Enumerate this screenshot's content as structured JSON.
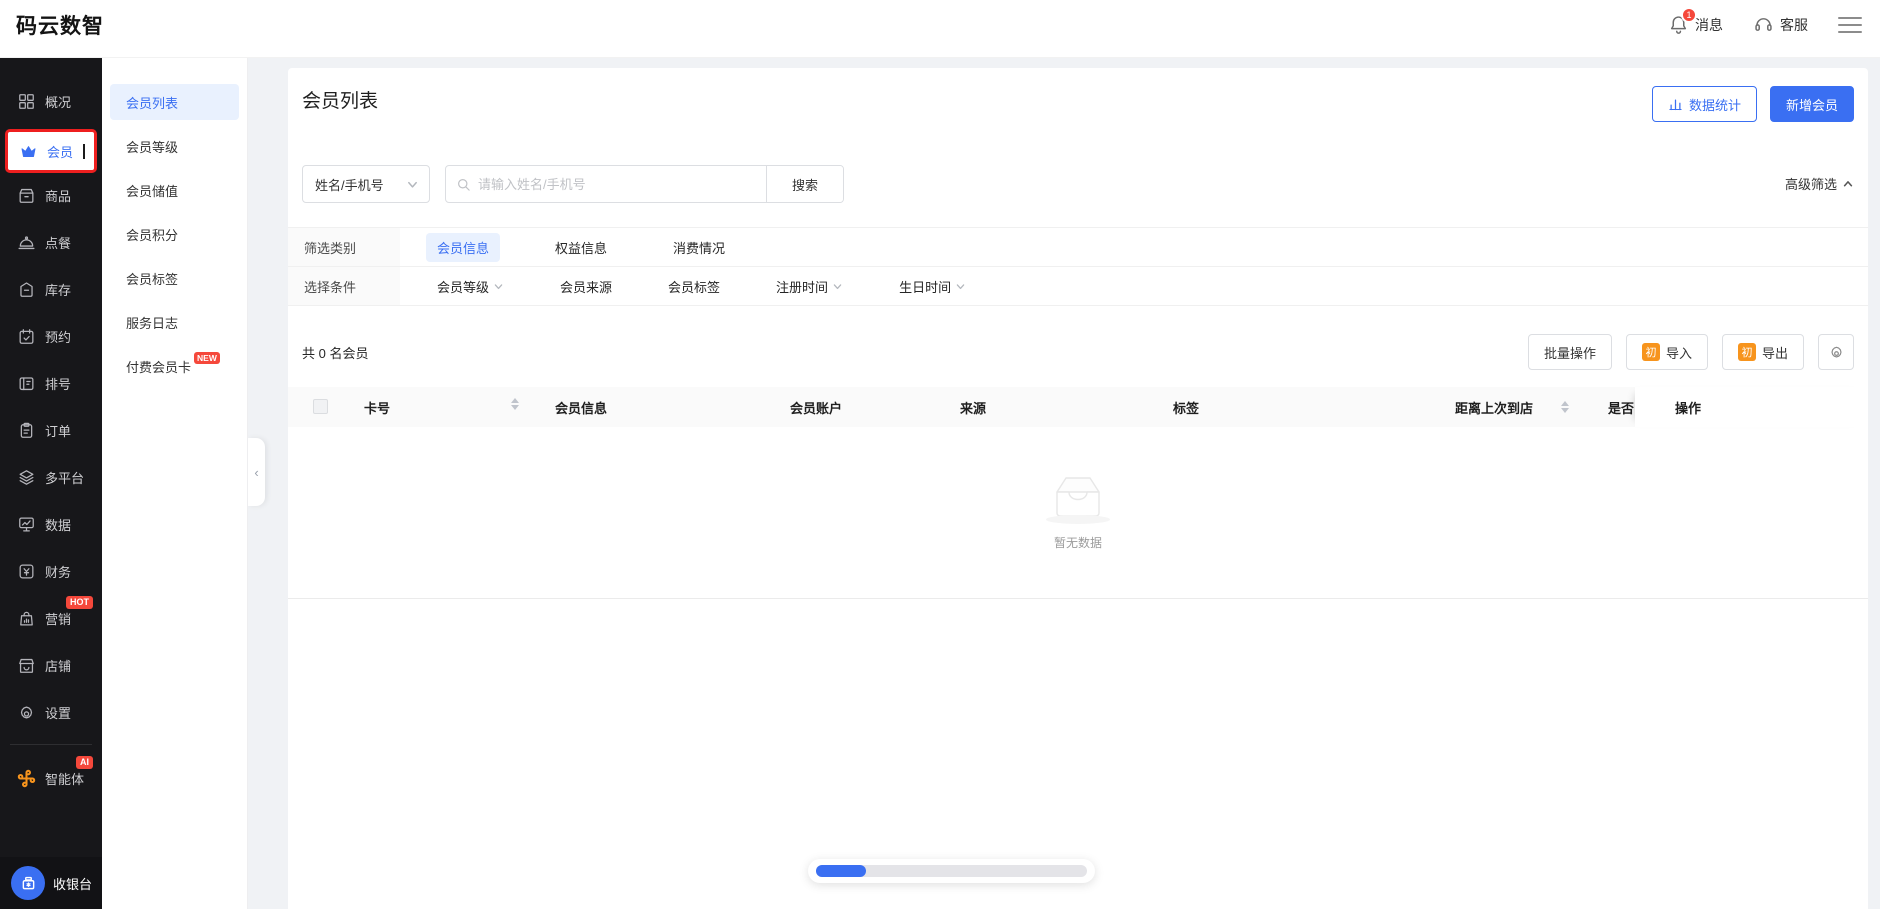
{
  "header": {
    "logo": "码云数智",
    "messages_label": "消息",
    "messages_badge": "1",
    "support_label": "客服"
  },
  "sidebar": {
    "items": [
      {
        "label": "概况",
        "icon": "grid-icon"
      },
      {
        "label": "会员",
        "icon": "crown-icon",
        "active": true
      },
      {
        "label": "商品",
        "icon": "goods-icon"
      },
      {
        "label": "点餐",
        "icon": "dish-icon"
      },
      {
        "label": "库存",
        "icon": "inventory-icon"
      },
      {
        "label": "预约",
        "icon": "calendar-icon"
      },
      {
        "label": "排号",
        "icon": "queue-icon"
      },
      {
        "label": "订单",
        "icon": "order-icon"
      },
      {
        "label": "多平台",
        "icon": "layers-icon"
      },
      {
        "label": "数据",
        "icon": "data-icon"
      },
      {
        "label": "财务",
        "icon": "finance-icon"
      },
      {
        "label": "营销",
        "icon": "marketing-icon",
        "badge": "HOT"
      },
      {
        "label": "店铺",
        "icon": "shop-icon"
      },
      {
        "label": "设置",
        "icon": "settings-icon"
      }
    ],
    "agent": {
      "label": "智能体",
      "badge": "AI"
    },
    "cashier": {
      "label": "收银台"
    }
  },
  "submenu": {
    "items": [
      {
        "label": "会员列表",
        "active": true
      },
      {
        "label": "会员等级"
      },
      {
        "label": "会员储值"
      },
      {
        "label": "会员积分"
      },
      {
        "label": "会员标签"
      },
      {
        "label": "服务日志"
      },
      {
        "label": "付费会员卡",
        "badge": "NEW"
      }
    ]
  },
  "main": {
    "title": "会员列表",
    "stats_button": "数据统计",
    "add_button": "新增会员",
    "search": {
      "field_select": "姓名/手机号",
      "placeholder": "请输入姓名/手机号",
      "search_button": "搜索",
      "advanced_filter": "高级筛选"
    },
    "filter": {
      "category_label": "筛选类别",
      "categories": [
        "会员信息",
        "权益信息",
        "消费情况"
      ],
      "condition_label": "选择条件",
      "conditions": [
        {
          "label": "会员等级",
          "dropdown": true
        },
        {
          "label": "会员来源",
          "dropdown": false
        },
        {
          "label": "会员标签",
          "dropdown": false
        },
        {
          "label": "注册时间",
          "dropdown": true
        },
        {
          "label": "生日时间",
          "dropdown": true
        }
      ]
    },
    "toolbar": {
      "count_text": "共 0 名会员",
      "batch_button": "批量操作",
      "import_button": "导入",
      "export_button": "导出",
      "feature_badge": "初"
    },
    "table": {
      "columns": {
        "card_no": "卡号",
        "member_info": "会员信息",
        "member_account": "会员账户",
        "source": "来源",
        "tags": "标签",
        "last_visit": "距离上次到店",
        "clipped": "是否",
        "actions": "操作"
      },
      "empty_text": "暂无数据"
    }
  },
  "colors": {
    "accent_blue": "#3a6ff2",
    "sidebar_bg": "#17171a",
    "annotation_red": "#ee1f1f",
    "badge_orange": "#f7941d",
    "badge_red": "#f5483b",
    "page_bg": "#f0f2f5",
    "selected_item_bg": "#e9f1fe"
  }
}
